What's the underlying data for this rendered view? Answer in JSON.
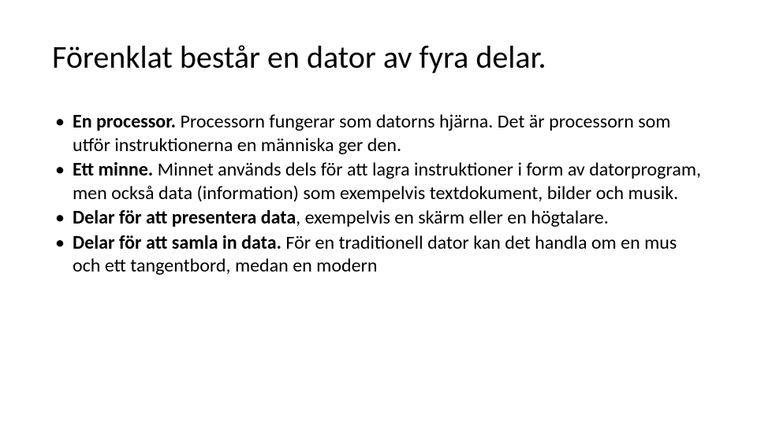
{
  "slide": {
    "title": "Förenklat består en dator av fyra delar.",
    "bullets": [
      {
        "bold": "En processor.",
        "rest": " Processorn fungerar som datorns hjärna. Det är processorn som utför instruktionerna en människa ger den."
      },
      {
        "bold": "Ett minne.",
        "rest": " Minnet används dels för att lagra instruktioner i form av datorprogram, men också data (information) som exempelvis textdokument, bilder och musik."
      },
      {
        "bold": "Delar för att presentera data",
        "rest": ", exempelvis en skärm eller en högtalare."
      },
      {
        "bold": "Delar för att samla in data.",
        "rest": " För en traditionell dator kan det handla om en mus och ett tangentbord, medan en modern"
      }
    ]
  }
}
